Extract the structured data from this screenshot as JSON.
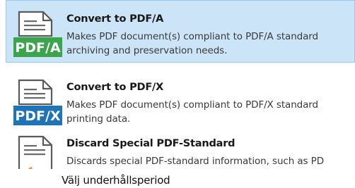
{
  "menu": {
    "items": [
      {
        "title": "Convert to PDF/A",
        "desc_line1": "Makes PDF document(s) compliant to PDF/A standard",
        "desc_line2": "archiving and preservation needs.",
        "badge": "PDF/A",
        "badge_color": "#3aa54a",
        "icon": "pdfa-document-icon",
        "selected": true
      },
      {
        "title": "Convert to PDF/X",
        "desc_line1": "Makes PDF document(s) compliant to PDF/X standard",
        "desc_line2": "printing data.",
        "badge": "PDF/X",
        "badge_color": "#1f73b7",
        "icon": "pdfx-document-icon",
        "selected": false
      },
      {
        "title": "Discard Special PDF-Standard",
        "desc_line1": "Discards special PDF-standard information, such as PD",
        "badge": "",
        "badge_color": "#f08a24",
        "icon": "discard-standard-icon",
        "selected": false
      }
    ]
  },
  "caption": "Välj underhållsperiod",
  "colors": {
    "selected_bg": "#cce4f7",
    "selected_border": "#99c9ef"
  }
}
